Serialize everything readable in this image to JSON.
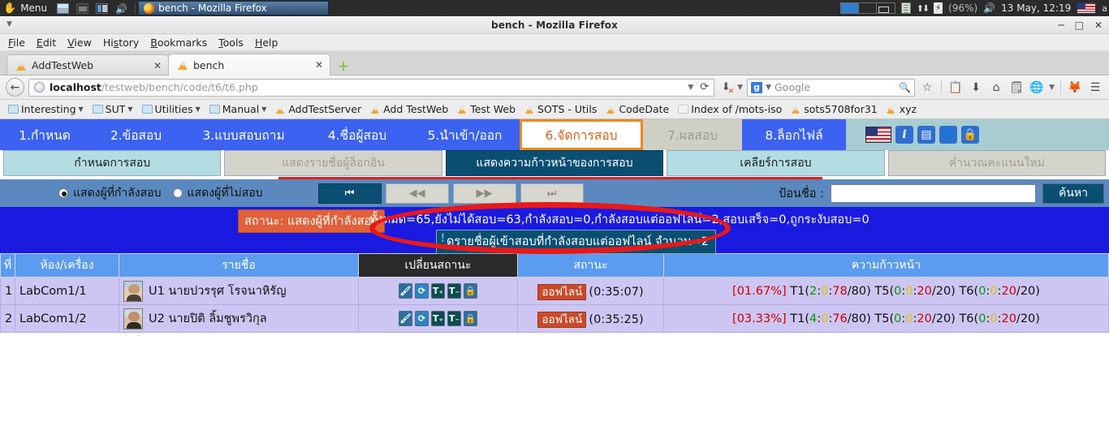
{
  "taskbar": {
    "menu_label": "Menu",
    "window_title": "bench - Mozilla Firefox",
    "battery": "(96%)",
    "clock": "13 May, 12:19",
    "lang": "a",
    "icons": [
      "hand-menu-icon",
      "terminal-icon",
      "files-icon",
      "split-view-icon",
      "speaker-icon",
      "notes-icon",
      "network-updown-icon",
      "power-icon",
      "volume-icon",
      "us-flag-icon"
    ]
  },
  "browser": {
    "title": "bench - Mozilla Firefox",
    "window_buttons": [
      "minimize",
      "maximize",
      "close"
    ],
    "menu": [
      "File",
      "Edit",
      "View",
      "History",
      "Bookmarks",
      "Tools",
      "Help"
    ],
    "tabs": [
      {
        "label": "AddTestWeb",
        "active": false
      },
      {
        "label": "bench",
        "active": true
      }
    ],
    "new_tab_label": "+",
    "url_host": "localhost",
    "url_path": "/testweb/bench/code/t6/t6.php",
    "search_engine": "Google",
    "search_placeholder": "Google",
    "bookmarks": [
      {
        "label": "Interesting",
        "type": "folder"
      },
      {
        "label": "SUT",
        "type": "folder"
      },
      {
        "label": "Utilities",
        "type": "folder"
      },
      {
        "label": "Manual",
        "type": "folder"
      },
      {
        "label": "AddTestServer",
        "type": "page"
      },
      {
        "label": "Add TestWeb",
        "type": "page"
      },
      {
        "label": "Test Web",
        "type": "page"
      },
      {
        "label": "SOTS - Utils",
        "type": "page"
      },
      {
        "label": "CodeDate",
        "type": "page"
      },
      {
        "label": "Index of /mots-iso",
        "type": "dashed"
      },
      {
        "label": "sots5708for31",
        "type": "page"
      },
      {
        "label": "xyz",
        "type": "page"
      }
    ]
  },
  "app": {
    "main_tabs": [
      {
        "label": "1.กำหนด",
        "state": "normal"
      },
      {
        "label": "2.ข้อสอบ",
        "state": "normal"
      },
      {
        "label": "3.แบบสอบถาม",
        "state": "normal"
      },
      {
        "label": "4.ชื่อผู้สอบ",
        "state": "normal"
      },
      {
        "label": "5.นำเข้า/ออก",
        "state": "normal"
      },
      {
        "label": "6.จัดการสอบ",
        "state": "selected"
      },
      {
        "label": "7.ผลสอบ",
        "state": "disabled"
      },
      {
        "label": "8.ล็อกไฟล์",
        "state": "normal"
      }
    ],
    "toolbar_icons": [
      "us-flag-icon",
      "info-icon",
      "document-icon",
      "user-icon",
      "lock-icon"
    ],
    "sub_tabs": [
      {
        "label": "กำหนดการสอบ",
        "state": "normal"
      },
      {
        "label": "แสดงรายชื่อผู้ล็อกอิน",
        "state": "disabled"
      },
      {
        "label": "แสดงความก้าวหน้าของการสอบ",
        "state": "selected"
      },
      {
        "label": "เคลียร์การสอบ",
        "state": "normal"
      },
      {
        "label": "คำนวณคะแนนใหม่",
        "state": "disabled"
      }
    ],
    "controls": {
      "radio_showing_label": "แสดงผู้ที่กำลังสอบ",
      "radio_notexam_label": "แสดงผู้ที่ไม่สอบ",
      "radio_selected": "showing",
      "nav_first": "⏮",
      "nav_prev": "◀◀",
      "nav_next": "▶▶",
      "nav_last": "⏭",
      "search_label": "ป้อนชื่อ :",
      "search_value": "",
      "search_placeholder": "",
      "search_button": "ค้นหา"
    },
    "status": {
      "tag": "สถานะ: แสดงผู้ที่กำลังสอบ",
      "text": "ทั้งหมด=65,ยังไม่ได้สอบ=63,กำลังสอบ=0,กำลังสอบแต่ออฟไลน์=2,สอบเสร็จ=0,ถูกระงับสอบ=0",
      "offline_button": "ดูรายชื่อผู้เข้าสอบที่กำลังสอบแต่ออฟไลน์ จำนวน=2",
      "highlight_shape": "red-ellipse"
    },
    "table": {
      "headers": [
        "ที่",
        "ห้อง/เครื่อง",
        "รายชื่อ",
        "เปลี่ยนสถานะ",
        "สถานะ",
        "ความก้าวหน้า"
      ],
      "rows": [
        {
          "no": "1",
          "room": "LabCom1/1",
          "name": "U1 นายปวรรุศ โรจนาหิรัญ",
          "actions": [
            "clear-icon",
            "refresh-icon",
            "time-plus-icon",
            "time-minus-icon",
            "lock-icon"
          ],
          "status_pill": "ออฟไลน์",
          "status_time": "(0:35:07)",
          "progress_percent": "[01.67%]",
          "progress_parts": [
            {
              "label": "T1",
              "green": "2",
              "yellow": "0",
              "red": "78",
              "total": "80"
            },
            {
              "label": "T5",
              "green": "0",
              "yellow": "0",
              "red": "20",
              "total": "20"
            },
            {
              "label": "T6",
              "green": "0",
              "yellow": "0",
              "red": "20",
              "total": "20"
            }
          ]
        },
        {
          "no": "2",
          "room": "LabCom1/2",
          "name": "U2 นายปิติ ลิ้มชูพรวิกุล",
          "actions": [
            "clear-icon",
            "refresh-icon",
            "time-plus-icon",
            "time-minus-icon",
            "lock-icon"
          ],
          "status_pill": "ออฟไลน์",
          "status_time": "(0:35:25)",
          "progress_percent": "[03.33%]",
          "progress_parts": [
            {
              "label": "T1",
              "green": "4",
              "yellow": "0",
              "red": "76",
              "total": "80"
            },
            {
              "label": "T5",
              "green": "0",
              "yellow": "0",
              "red": "20",
              "total": "20"
            },
            {
              "label": "T6",
              "green": "0",
              "yellow": "0",
              "red": "20",
              "total": "20"
            }
          ]
        }
      ]
    },
    "colors": {
      "accent_blue": "#3b62f0",
      "selected_tab_border": "#e98a1f",
      "dark_teal": "#0a4f72",
      "status_band": "#1a1ae0",
      "highlight_red": "#e81919",
      "row_bg": "#cdc6f2"
    }
  }
}
